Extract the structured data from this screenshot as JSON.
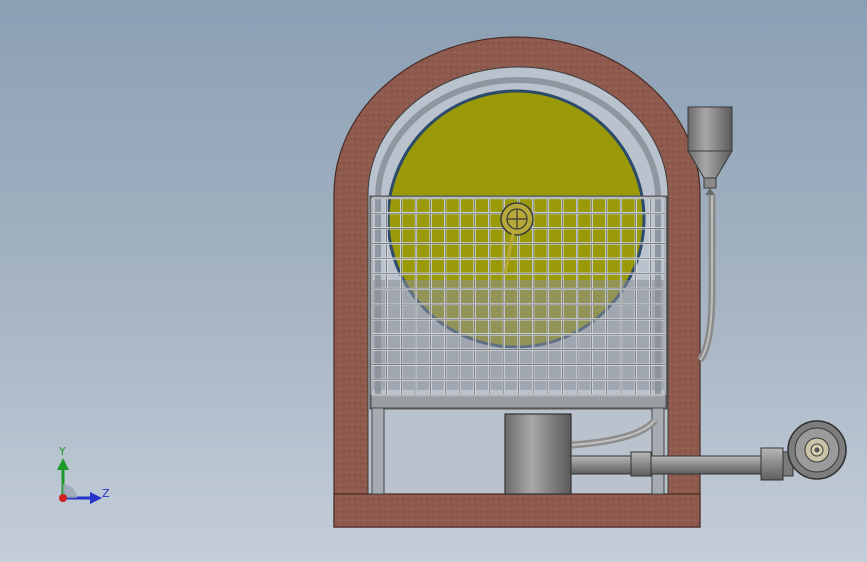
{
  "triad": {
    "y_label": "Y",
    "z_label": "Z",
    "y_color": "#1e9a2a",
    "z_color": "#2433c8",
    "x_color": "#d02020"
  },
  "colors": {
    "background_top": "#8b9fb4",
    "background_bottom": "#c4ced9",
    "brick": "#8e5a4e",
    "drum": "#9a9a08",
    "metal": "#8c8c8c",
    "grid": "#d9dde3"
  }
}
